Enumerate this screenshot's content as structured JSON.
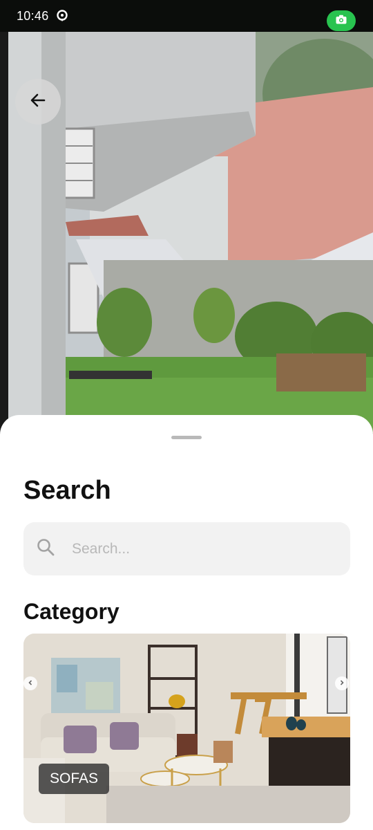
{
  "status_bar": {
    "time": "10:46",
    "left_icon": "location-pin-icon",
    "right_icon": "camera-icon",
    "camera_indicator_color": "#28c34f"
  },
  "camera_view": {
    "back_icon": "arrow-left-icon"
  },
  "sheet": {
    "title": "Search",
    "search": {
      "placeholder": "Search...",
      "value": "",
      "icon": "search-icon"
    },
    "category_title": "Category",
    "categories": [
      {
        "label": "SOFAS"
      }
    ]
  }
}
